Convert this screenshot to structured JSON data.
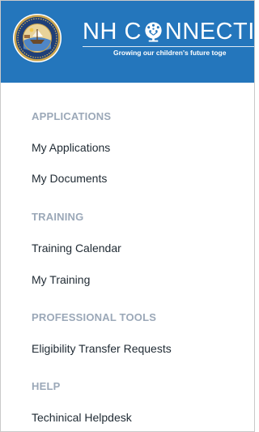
{
  "header": {
    "brand_prefix": "NH C",
    "brand_suffix": "NNECTI",
    "tagline": "Growing our children's future toge",
    "seal_icon": "nh-state-seal-icon",
    "tree_icon": "tree-icon",
    "colors": {
      "header_bg": "#2476bc",
      "text": "#ffffff"
    }
  },
  "nav": {
    "sections": [
      {
        "label": "APPLICATIONS",
        "items": [
          {
            "label": "My Applications"
          },
          {
            "label": "My Documents"
          }
        ]
      },
      {
        "label": "TRAINING",
        "items": [
          {
            "label": "Training Calendar"
          },
          {
            "label": "My Training"
          }
        ]
      },
      {
        "label": "PROFESSIONAL TOOLS",
        "items": [
          {
            "label": "Eligibility Transfer Requests"
          }
        ]
      },
      {
        "label": "HELP",
        "items": [
          {
            "label": "Techinical Helpdesk"
          }
        ]
      }
    ],
    "colors": {
      "section_label": "#9ba8b8",
      "item_text": "#1f2a33"
    }
  }
}
